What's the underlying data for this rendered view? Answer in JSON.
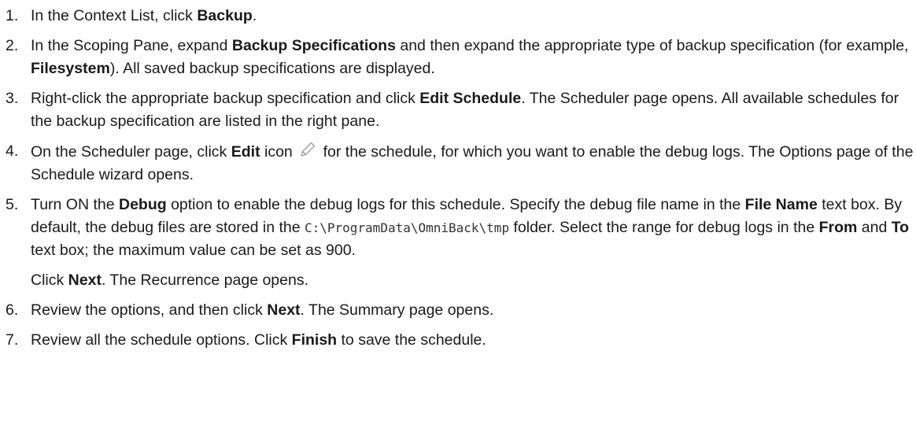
{
  "steps": [
    {
      "num": "1.",
      "parts": [
        {
          "t": "In the Context List, click "
        },
        {
          "b": "Backup"
        },
        {
          "t": "."
        }
      ]
    },
    {
      "num": "2.",
      "parts": [
        {
          "t": "In the Scoping Pane, expand "
        },
        {
          "b": "Backup Specifications"
        },
        {
          "t": " and then expand the appropriate type of backup specification (for example, "
        },
        {
          "b": "Filesystem"
        },
        {
          "t": "). All saved backup specifications are displayed."
        }
      ]
    },
    {
      "num": "3.",
      "parts": [
        {
          "t": "Right-click the appropriate backup specification and click "
        },
        {
          "b": "Edit Schedule"
        },
        {
          "t": ". The Scheduler page opens. All available schedules for the backup specification are listed in the right pane."
        }
      ]
    },
    {
      "num": "4.",
      "parts": [
        {
          "t": "On the Scheduler page, click "
        },
        {
          "b": "Edit"
        },
        {
          "t": " icon "
        },
        {
          "icon": "pencil-edit-icon"
        },
        {
          "t": " for the schedule, for which you want to enable the debug logs. The Options page of the Schedule wizard opens."
        }
      ]
    },
    {
      "num": "5.",
      "parts": [
        {
          "t": "Turn ON the "
        },
        {
          "b": "Debug"
        },
        {
          "t": " option to enable the debug logs for this schedule. Specify the debug file name in the "
        },
        {
          "b": "File Name"
        },
        {
          "t": " text box. By default, the debug files are stored in the "
        },
        {
          "code": "C:\\ProgramData\\OmniBack\\tmp"
        },
        {
          "t": " folder. Select the range for debug logs in the "
        },
        {
          "b": "From"
        },
        {
          "t": " and "
        },
        {
          "b": "To"
        },
        {
          "t": " text box; the maximum value can be set as 900."
        }
      ],
      "extra": [
        {
          "t": "Click "
        },
        {
          "b": "Next"
        },
        {
          "t": ". The Recurrence page opens."
        }
      ]
    },
    {
      "num": "6.",
      "parts": [
        {
          "t": "Review the options, and then click "
        },
        {
          "b": "Next"
        },
        {
          "t": ". The Summary page opens."
        }
      ]
    },
    {
      "num": "7.",
      "parts": [
        {
          "t": "Review all the schedule options. Click "
        },
        {
          "b": "Finish"
        },
        {
          "t": " to save the schedule."
        }
      ]
    }
  ],
  "colors": {
    "text": "#1a1a1a",
    "icon_stroke": "#9a9a9a"
  }
}
